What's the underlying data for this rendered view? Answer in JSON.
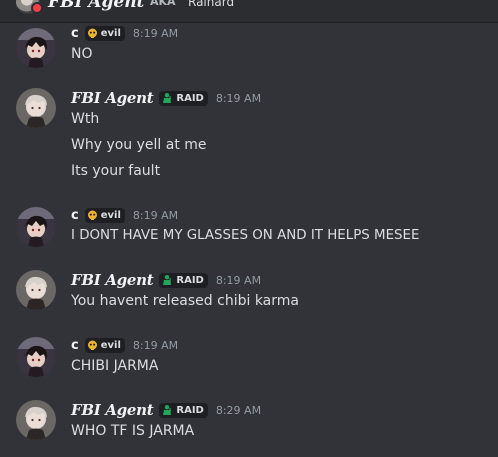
{
  "topbar": {
    "name": "FBI Agent",
    "aka_label": "AKA",
    "aka_name": "Rainard"
  },
  "tags": {
    "evil": "evil",
    "raid": "RAID"
  },
  "messages": [
    {
      "author": "c",
      "tag": "evil",
      "time": "8:19 AM",
      "lines": [
        "NO"
      ]
    },
    {
      "author": "FBI Agent",
      "tag": "RAID",
      "time": "8:19 AM",
      "lines": [
        "Wth",
        "Why you yell at me",
        "Its your fault"
      ]
    },
    {
      "author": "c",
      "tag": "evil",
      "time": "8:19 AM",
      "lines": [
        "I DONT HAVE MY GLASSES ON AND IT HELPS MESEE"
      ]
    },
    {
      "author": "FBI Agent",
      "tag": "RAID",
      "time": "8:19 AM",
      "lines": [
        "You havent released chibi karma"
      ]
    },
    {
      "author": "c",
      "tag": "evil",
      "time": "8:19 AM",
      "lines": [
        "CHIBI JARMA"
      ]
    },
    {
      "author": "FBI Agent",
      "tag": "RAID",
      "time": "8:29 AM",
      "lines": [
        "WHO TF IS JARMA"
      ]
    }
  ],
  "colors": {
    "background": "#313338",
    "text": "#dbdee1",
    "timestamp": "#949ba4",
    "tag_bg": "#1e1f22",
    "raid_icon": "#23a55a",
    "evil_icon": "#f0b232"
  },
  "icons": {
    "evil_tag": "skull-icon",
    "raid_tag": "soldier-icon"
  }
}
